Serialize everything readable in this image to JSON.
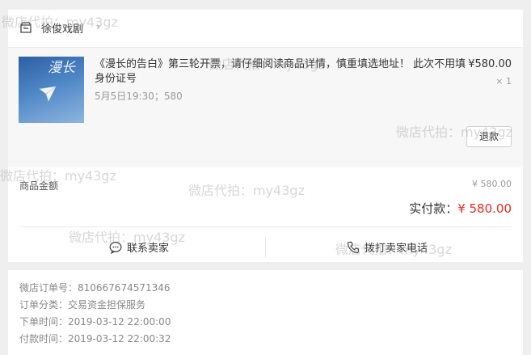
{
  "shop": {
    "name": "徐俊戏剧",
    "chevron": "›"
  },
  "goods": {
    "cover_text": "漫长",
    "title": "《漫长的告白》第三轮开票，请仔细阅读商品详情，慎重填选地址！ 此次不用填身份证号",
    "sku": "5月5日19:30；580",
    "price": "¥580.00",
    "quantity": "× 1",
    "refund_label": "退款"
  },
  "summary": {
    "goods_amount_label": "商品金额",
    "goods_amount_value": "¥ 580.00",
    "paid_label": "实付款：",
    "paid_value": "¥ 580.00"
  },
  "actions": {
    "contact_seller": "联系卖家",
    "call_seller": "拨打卖家电话"
  },
  "order_info": [
    "微店订单号：810667674571346",
    "订单分类：交易资金担保服务",
    "下单时间：2019-03-12 22:00:00",
    "付款时间：2019-03-12 22:00:32"
  ],
  "watermark": "微店代拍：my43gz",
  "colors": {
    "accent_red": "#e02e24",
    "page_bg": "#efefef",
    "goods_bg": "#f7f7f7"
  },
  "icons": [
    "shop-icon",
    "chat-bubble-icon",
    "phone-icon",
    "paper-plane-icon"
  ]
}
